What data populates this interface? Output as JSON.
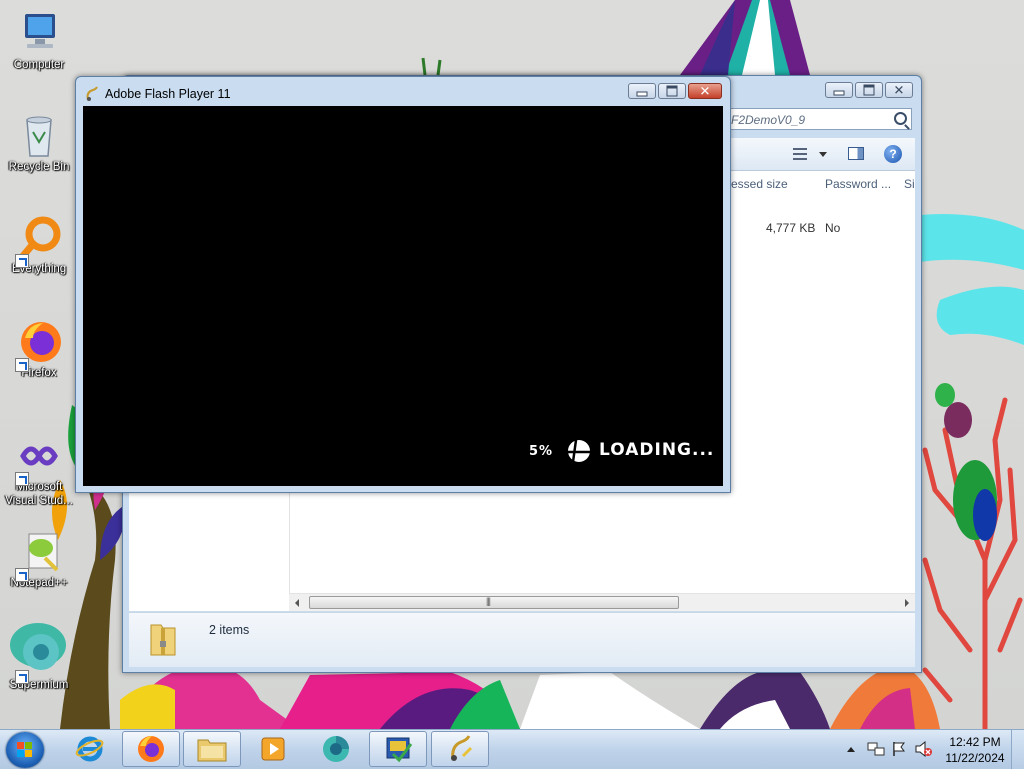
{
  "desktop": {
    "icons": [
      {
        "name": "computer",
        "label": "Computer"
      },
      {
        "name": "recycle-bin",
        "label": "Recycle Bin"
      },
      {
        "name": "everything",
        "label": "Everything"
      },
      {
        "name": "firefox",
        "label": "Firefox"
      },
      {
        "name": "visual-studio",
        "label": "Microsoft Visual Stud..."
      },
      {
        "name": "notepadpp",
        "label": "Notepad++"
      },
      {
        "name": "supermium",
        "label": "Supermium"
      }
    ]
  },
  "explorer": {
    "search_text": "F2DemoV0_9",
    "columns": [
      "ressed size",
      "Password ...",
      "Si"
    ],
    "row": {
      "compressed_size": "4,777 KB",
      "password": "No"
    },
    "status": "2 items"
  },
  "flash": {
    "title": "Adobe Flash Player 11",
    "loading_percent": "5%",
    "loading_text": "LOADING...",
    "loading_fraction": 0.05
  },
  "taskbar": {
    "items": [
      "internet-explorer",
      "firefox",
      "file-explorer",
      "media-player",
      "supermium",
      "visual-studio",
      "flash-player"
    ],
    "clock_time": "12:42 PM",
    "clock_date": "11/22/2024"
  },
  "colors": {
    "titlebar": "#c9dcf0",
    "close_button": "#c4412a",
    "taskbar": "#bfd3ea",
    "flash_canvas": "#000000"
  }
}
